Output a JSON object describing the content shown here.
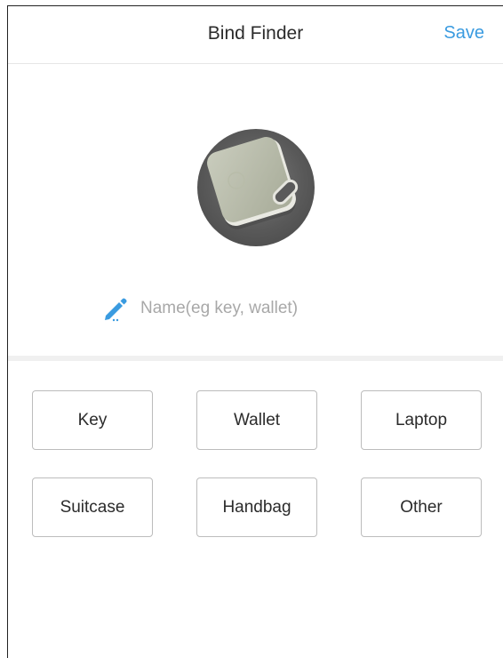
{
  "header": {
    "title": "Bind Finder",
    "save_label": "Save"
  },
  "device": {
    "image": "tracker-tag-photo"
  },
  "name_field": {
    "icon": "pencil-icon",
    "placeholder": "Name(eg key, wallet)",
    "value": ""
  },
  "categories": [
    {
      "label": "Key"
    },
    {
      "label": "Wallet"
    },
    {
      "label": "Laptop"
    },
    {
      "label": "Suitcase"
    },
    {
      "label": "Handbag"
    },
    {
      "label": "Other"
    }
  ],
  "colors": {
    "accent": "#3a9be0",
    "button_border": "#bcbcbc",
    "divider": "#f0f0f0"
  }
}
